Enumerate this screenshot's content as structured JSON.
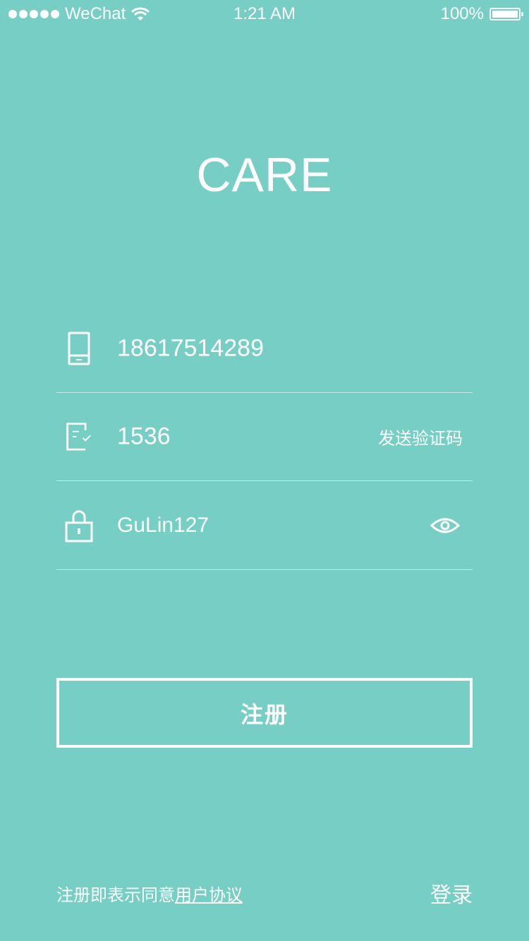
{
  "status_bar": {
    "carrier": "WeChat",
    "time": "1:21 AM",
    "battery_percent": "100%",
    "battery_level": 1.0,
    "signal_dots": 5
  },
  "app": {
    "logo": "CARE"
  },
  "form": {
    "phone": {
      "value": "18617514289",
      "icon": "phone-icon"
    },
    "code": {
      "value": "1536",
      "icon": "verification-code-icon",
      "send_code_label": "发送验证码"
    },
    "password": {
      "value": "GuLin127",
      "icon": "lock-icon",
      "toggle_icon": "eye-icon"
    },
    "submit_label": "注册"
  },
  "footer": {
    "agreement_prefix": "注册即表示同意",
    "agreement_link": "用户协议",
    "login_label": "登录"
  },
  "colors": {
    "background": "#76CEC5",
    "foreground": "#FFFFFF"
  }
}
